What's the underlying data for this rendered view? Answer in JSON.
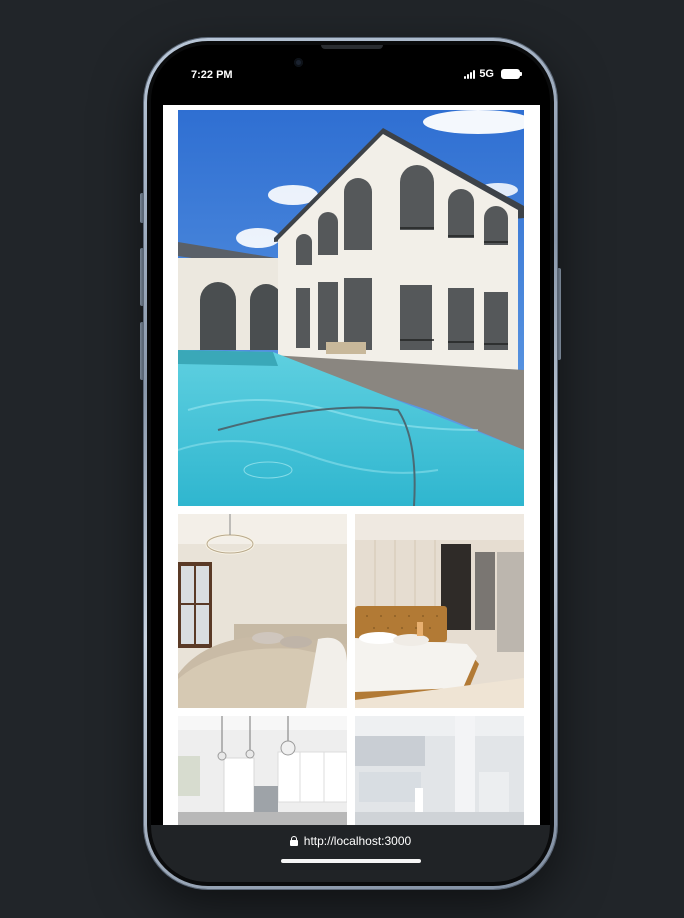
{
  "status_bar": {
    "time": "7:22 PM",
    "network": "5G",
    "signal_icon": "signal-bars-icon",
    "battery_icon": "battery-full-icon"
  },
  "gallery": {
    "images": [
      {
        "id": "main",
        "subject": "pool-villa-exterior"
      },
      {
        "id": "bed1",
        "subject": "bedroom-chandelier"
      },
      {
        "id": "bed2",
        "subject": "bedroom-tufted-headboard"
      },
      {
        "id": "kitchen",
        "subject": "kitchen-pendants"
      },
      {
        "id": "bath",
        "subject": "bathroom"
      }
    ]
  },
  "browser": {
    "url": "http://localhost:3000",
    "lock_icon": "lock-icon"
  },
  "colors": {
    "background": "#212529",
    "url_bar": "#202326",
    "page": "#ffffff"
  }
}
